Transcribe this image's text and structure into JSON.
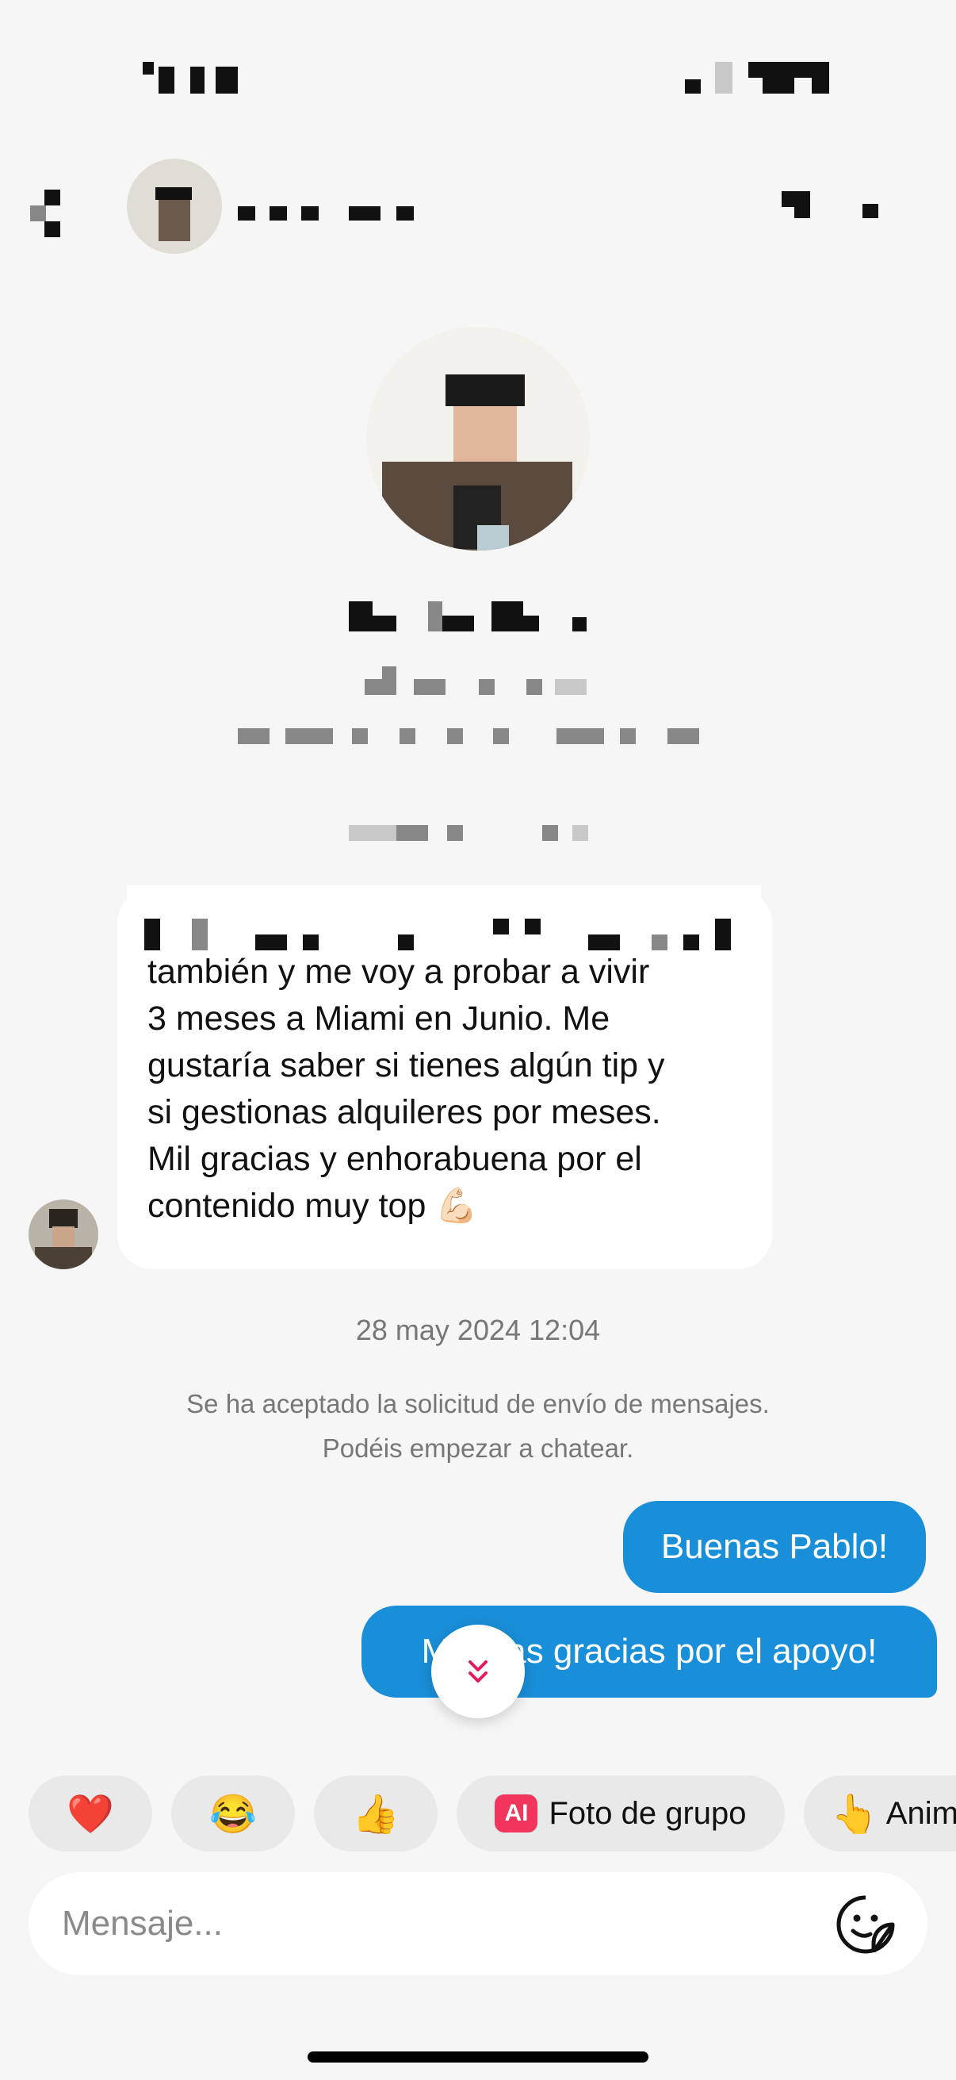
{
  "conversation": {
    "message_lines": [
      "también y me voy a probar a vivir",
      "3 meses a Miami en Junio. Me",
      "gustaría saber si tienes algún tip y",
      "si gestionas alquileres por meses.",
      "Mil gracias y enhorabuena por el",
      "contenido muy top 💪🏻"
    ],
    "timestamp": "28 may 2024 12:04",
    "system_line1": "Se ha aceptado la solicitud de envío de mensajes.",
    "system_line2": "Podéis empezar a chatear.",
    "outgoing": [
      "Buenas Pablo!",
      "Muchas gracias por el apoyo!"
    ]
  },
  "quick_replies": {
    "heart": "❤️",
    "laugh": "😂",
    "thumbs": "👍",
    "ai_badge": "AI",
    "group_photo": "Foto de grupo",
    "animate_emoji": "👆",
    "animate_label": "Anim"
  },
  "composer": {
    "placeholder": "Mensaje..."
  },
  "colors": {
    "outgoing_bubble": "#1a8fd9",
    "ai_badge": "#f2355d",
    "scroll_arrow": "#e8195a"
  }
}
